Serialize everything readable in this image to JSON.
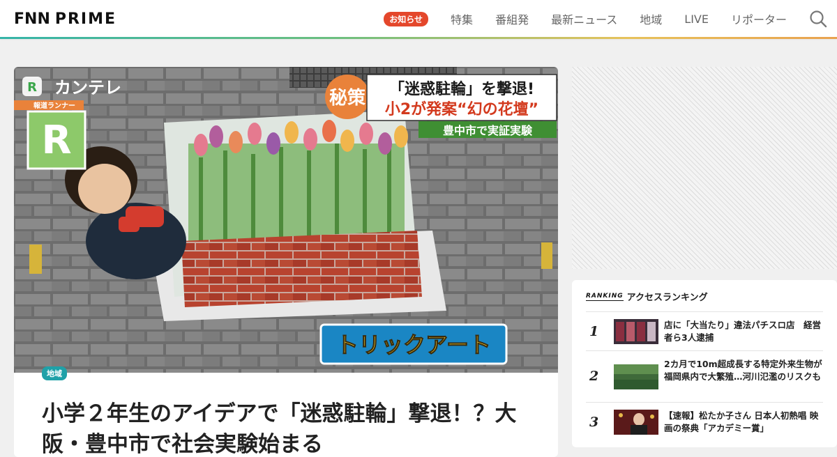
{
  "header": {
    "logo_fnn": "FNN",
    "logo_prime": "PRIME",
    "notice_badge": "お知らせ",
    "nav": [
      "特集",
      "番組発",
      "最新ニュース",
      "地域",
      "LIVE",
      "リポーター"
    ],
    "search_icon": "search-icon"
  },
  "article": {
    "image_overlay": {
      "station": "カンテレ",
      "corner": "報道ランナー",
      "badge": "秘策",
      "caption_line1": "「迷惑駐輪」を撃退!",
      "caption_line2": "小2が発案“幻の花壇”",
      "caption_line3": "豊中市で実証実験",
      "trick_art": "トリックアート"
    },
    "tag": "地域",
    "headline": "小学２年生のアイデアで「迷惑駐輪」撃退！？大阪・豊中市で社会実験始まる"
  },
  "ranking": {
    "label_en": "RANKING",
    "title": "アクセスランキング",
    "items": [
      {
        "rank": "1",
        "text": "店に「大当たり」違法パチスロ店　経営者ら3人逮捕"
      },
      {
        "rank": "2",
        "text": "2カ月で10m超成長する特定外来生物が福岡県内で大繁殖…河川氾濫のリスクも"
      },
      {
        "rank": "3",
        "text": "【速報】松たか子さん 日本人初熱唱 映画の祭典「アカデミー賞」"
      }
    ]
  },
  "colors": {
    "accent_badge": "#e4472b",
    "tag_teal": "#1fa1a8",
    "header_stripe": [
      "#35b4a8",
      "#e9a24f"
    ]
  }
}
